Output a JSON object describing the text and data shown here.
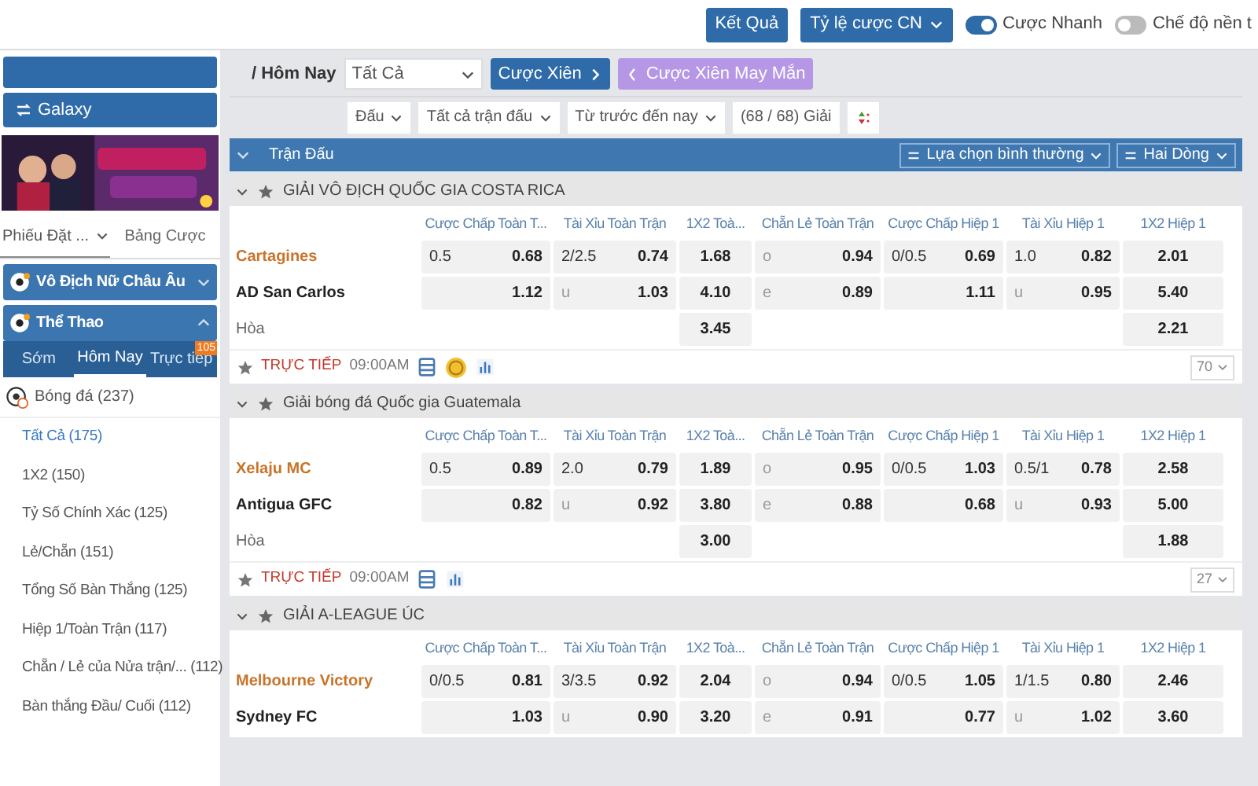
{
  "header": {
    "buttons": [
      {
        "label": "Kết Quả",
        "kind": "button"
      },
      {
        "label": "Tỷ lệ cược CN",
        "kind": "dropdown"
      }
    ],
    "toggles": [
      {
        "label": "Cược Nhanh",
        "on": true
      },
      {
        "label": "Chế độ nền t",
        "on": false
      }
    ]
  },
  "sidebar": {
    "galaxy_button": "Galaxy",
    "tabs": [
      {
        "label": "Phiếu Đặt ...",
        "selected": true
      },
      {
        "label": "Bảng Cược",
        "selected": false
      }
    ],
    "sections": [
      {
        "title": "Vô Địch Nữ Châu Âu",
        "expanded": false
      },
      {
        "title": "Thể Thao",
        "expanded": true
      }
    ],
    "sport_tabs": [
      {
        "label": "Sớm",
        "selected": false
      },
      {
        "label": "Hôm Nay",
        "selected": true
      },
      {
        "label": "Trực tiếp",
        "selected": false,
        "badge": "105"
      }
    ],
    "sport": {
      "label": "Bóng đá",
      "count": "(237)"
    },
    "markets": [
      {
        "label": "Tất Cả",
        "count": "(175)",
        "selected": true
      },
      {
        "label": "1X2",
        "count": "(150)",
        "selected": false
      },
      {
        "label": "Tỷ Số Chính Xác",
        "count": "(125)",
        "selected": false
      },
      {
        "label": "Lẻ/Chẵn",
        "count": "(151)",
        "selected": false
      },
      {
        "label": "Tổng Số Bàn Thắng",
        "count": "(125)",
        "selected": false
      },
      {
        "label": "Hiệp 1/Toàn Trận",
        "count": "(117)",
        "selected": false
      },
      {
        "label": "Chẵn / Lẻ của Nửa trận/...",
        "count": "(112)",
        "selected": false
      },
      {
        "label": "Bàn thắng Đầu/ Cuối",
        "count": "(112)",
        "selected": false
      }
    ]
  },
  "main": {
    "breadcrumb": "/ Hôm Nay",
    "filter_select": "Tất Cả",
    "parlay_button": "Cược Xiên",
    "lucky_parlay_button": "Cược Xiên May Mắn",
    "filters": [
      "Đấu",
      "Tất cả trận đấu",
      "Từ trước đến nay"
    ],
    "league_count": "(68 / 68) Giải",
    "matches_bar": {
      "title": "Trận Đấu",
      "options": [
        "Lựa chọn bình thường",
        "Hai Dòng"
      ]
    },
    "leagues": [
      {
        "name": "GIẢI VÔ ĐỊCH QUỐC GIA COSTA RICA",
        "expanded": true,
        "columns": [
          "Cược Chấp Toàn T...",
          "Tài Xỉu Toàn Trận",
          "1X2 Toà...",
          "Chẵn Lẻ Toàn Trận",
          "Cược Chấp Hiệp 1",
          "Tài Xỉu Hiệp 1",
          "1X2 Hiệp 1"
        ],
        "rows": [
          {
            "team": "Cartagines",
            "kind": "home",
            "cells": [
              {
                "line": "0.5",
                "odds": "0.68"
              },
              {
                "line": "2/2.5",
                "odds": "0.74"
              },
              {
                "odds": "1.68"
              },
              {
                "line": "o",
                "odds": "0.94"
              },
              {
                "line": "0/0.5",
                "odds": "0.69"
              },
              {
                "line": "1.0",
                "odds": "0.82"
              },
              {
                "odds": "2.01"
              }
            ]
          },
          {
            "team": "AD San Carlos",
            "kind": "away",
            "cells": [
              {
                "odds": "1.12"
              },
              {
                "line": "u",
                "odds": "1.03"
              },
              {
                "odds": "4.10"
              },
              {
                "line": "e",
                "odds": "0.89"
              },
              {
                "odds": "1.11"
              },
              {
                "line": "u",
                "odds": "0.95"
              },
              {
                "odds": "5.40"
              }
            ]
          },
          {
            "team": "Hòa",
            "kind": "draw",
            "cells": [
              null,
              null,
              {
                "odds": "3.45"
              },
              null,
              null,
              null,
              {
                "odds": "2.21"
              }
            ]
          }
        ],
        "footer": {
          "status": "TRỰC TIẾP",
          "time": "09:00AM",
          "icons": [
            {
              "kind": "list"
            },
            {
              "kind": "coin"
            },
            {
              "kind": "chart"
            }
          ],
          "more": "70"
        }
      },
      {
        "name": "Giải bóng đá Quốc gia Guatemala",
        "expanded": true,
        "columns": [
          "Cược Chấp Toàn T...",
          "Tài Xỉu Toàn Trận",
          "1X2 Toà...",
          "Chẵn Lẻ Toàn Trận",
          "Cược Chấp Hiệp 1",
          "Tài Xỉu Hiệp 1",
          "1X2 Hiệp 1"
        ],
        "rows": [
          {
            "team": "Xelaju MC",
            "kind": "home",
            "cells": [
              {
                "line": "0.5",
                "odds": "0.89"
              },
              {
                "line": "2.0",
                "odds": "0.79"
              },
              {
                "odds": "1.89"
              },
              {
                "line": "o",
                "odds": "0.95"
              },
              {
                "line": "0/0.5",
                "odds": "1.03"
              },
              {
                "line": "0.5/1",
                "odds": "0.78"
              },
              {
                "odds": "2.58"
              }
            ]
          },
          {
            "team": "Antigua GFC",
            "kind": "away",
            "cells": [
              {
                "odds": "0.82"
              },
              {
                "line": "u",
                "odds": "0.92"
              },
              {
                "odds": "3.80"
              },
              {
                "line": "e",
                "odds": "0.88"
              },
              {
                "odds": "0.68"
              },
              {
                "line": "u",
                "odds": "0.93"
              },
              {
                "odds": "5.00"
              }
            ]
          },
          {
            "team": "Hòa",
            "kind": "draw",
            "cells": [
              null,
              null,
              {
                "odds": "3.00"
              },
              null,
              null,
              null,
              {
                "odds": "1.88"
              }
            ]
          }
        ],
        "footer": {
          "status": "TRỰC TIẾP",
          "time": "09:00AM",
          "icons": [
            {
              "kind": "list"
            },
            {
              "kind": "chart"
            }
          ],
          "more": "27"
        }
      },
      {
        "name": "GIẢI A-LEAGUE ÚC",
        "expanded": true,
        "columns": [
          "Cược Chấp Toàn T...",
          "Tài Xỉu Toàn Trận",
          "1X2 Toà...",
          "Chẵn Lẻ Toàn Trận",
          "Cược Chấp Hiệp 1",
          "Tài Xỉu Hiệp 1",
          "1X2 Hiệp 1"
        ],
        "rows": [
          {
            "team": "Melbourne Victory",
            "kind": "home",
            "cells": [
              {
                "line": "0/0.5",
                "odds": "0.81"
              },
              {
                "line": "3/3.5",
                "odds": "0.92"
              },
              {
                "odds": "2.04"
              },
              {
                "line": "o",
                "odds": "0.94"
              },
              {
                "line": "0/0.5",
                "odds": "1.05"
              },
              {
                "line": "1/1.5",
                "odds": "0.80"
              },
              {
                "odds": "2.46"
              }
            ]
          },
          {
            "team": "Sydney FC",
            "kind": "away",
            "cells": [
              {
                "odds": "1.03"
              },
              {
                "line": "u",
                "odds": "0.90"
              },
              {
                "odds": "3.20"
              },
              {
                "line": "e",
                "odds": "0.91"
              },
              {
                "odds": "0.77"
              },
              {
                "line": "u",
                "odds": "1.02"
              },
              {
                "odds": "3.60"
              }
            ]
          }
        ]
      }
    ]
  }
}
